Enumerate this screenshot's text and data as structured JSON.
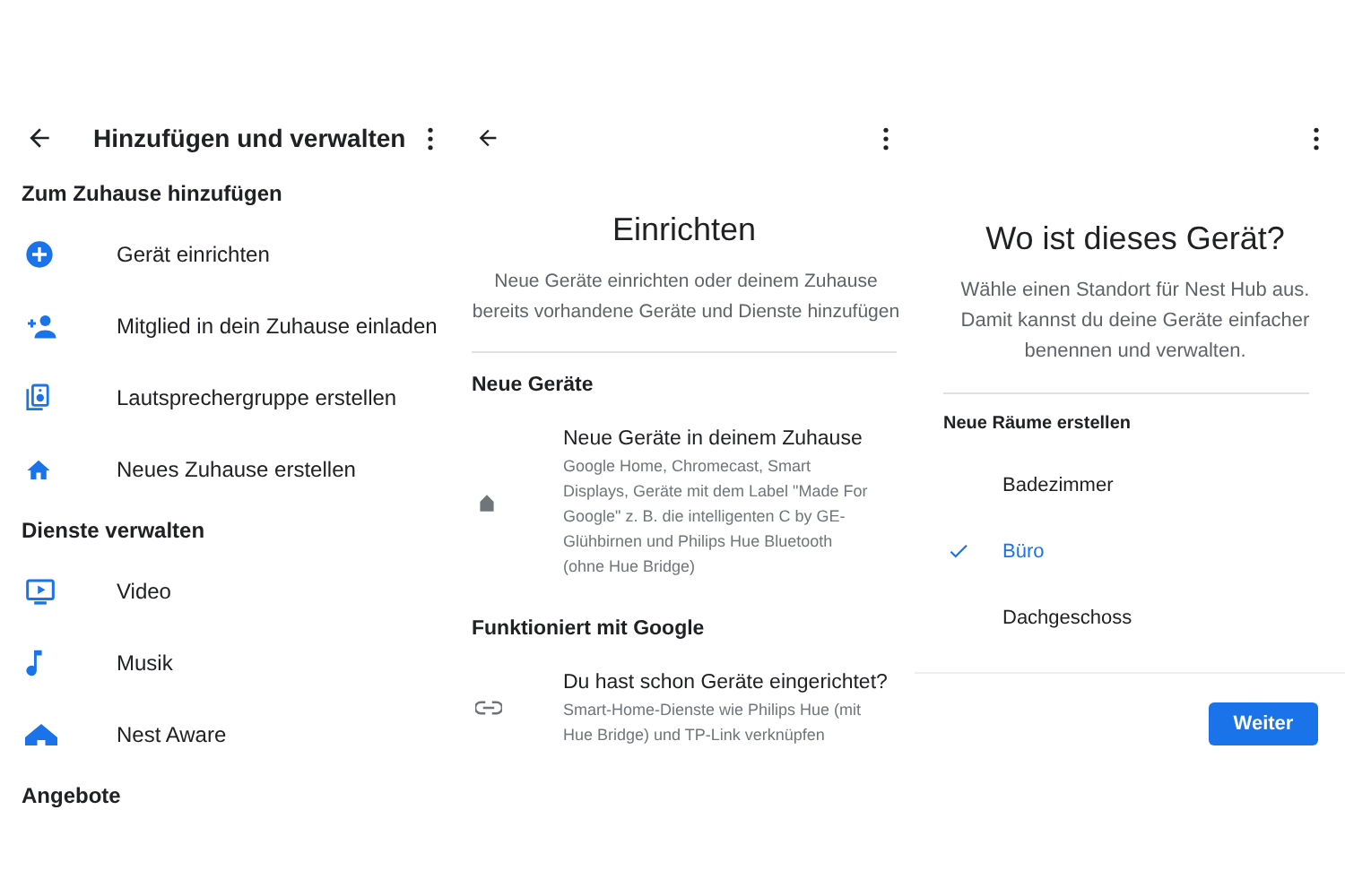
{
  "screens": [
    {
      "title": "Hinzufügen und verwalten",
      "sections": [
        {
          "heading": "Zum Zuhause hinzufügen",
          "items": [
            {
              "label": "Gerät einrichten"
            },
            {
              "label": "Mitglied in dein Zuhause einladen"
            },
            {
              "label": "Lautsprechergruppe erstellen"
            },
            {
              "label": "Neues Zuhause erstellen"
            }
          ]
        },
        {
          "heading": "Dienste verwalten",
          "items": [
            {
              "label": "Video"
            },
            {
              "label": "Musik"
            },
            {
              "label": "Nest Aware"
            }
          ]
        },
        {
          "heading": "Angebote"
        }
      ]
    },
    {
      "title": "Einrichten",
      "subtitle": "Neue Geräte einrichten oder deinem Zuhause bereits vorhandene Geräte und Dienste hinzufügen",
      "sections": [
        {
          "heading": "Neue Geräte",
          "items": [
            {
              "title": "Neue Geräte in deinem Zuhause",
              "description": "Google Home, Chromecast, Smart Displays, Geräte mit dem Label \"Made For Google\" z. B. die intelligenten C by GE-Glühbirnen und Philips Hue Bluetooth (ohne Hue Bridge)"
            }
          ]
        },
        {
          "heading": "Funktioniert mit Google",
          "items": [
            {
              "title": "Du hast schon Geräte eingerichtet?",
              "description": "Smart-Home-Dienste wie Philips Hue (mit Hue Bridge) und TP-Link verknüpfen"
            }
          ]
        }
      ]
    },
    {
      "title": "Wo ist dieses Gerät?",
      "subtitle": "Wähle einen Standort für Nest Hub aus. Damit kannst du deine Geräte einfacher benennen und verwalten.",
      "list_heading": "Neue Räume erstellen",
      "rooms": [
        {
          "label": "Badezimmer",
          "selected": false
        },
        {
          "label": "Büro",
          "selected": true
        },
        {
          "label": "Dachgeschoss",
          "selected": false
        }
      ],
      "button": "Weiter"
    }
  ]
}
